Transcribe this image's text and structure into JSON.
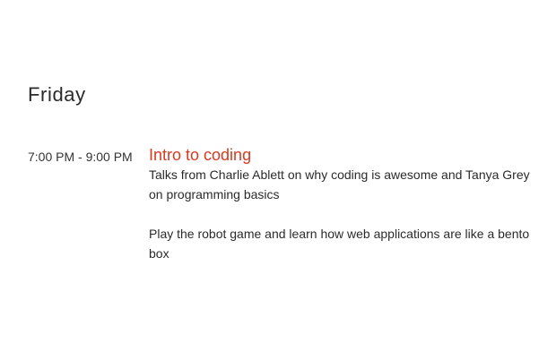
{
  "day": {
    "label": "Friday"
  },
  "event": {
    "time": "7:00 PM - 9:00 PM",
    "title": "Intro to coding",
    "paragraphs": [
      "Talks from Charlie Ablett on why coding is awesome and Tanya Grey on programming basics",
      "Play the robot game and learn how web applications are like a bento box"
    ],
    "title_color": "#d93a1f"
  }
}
